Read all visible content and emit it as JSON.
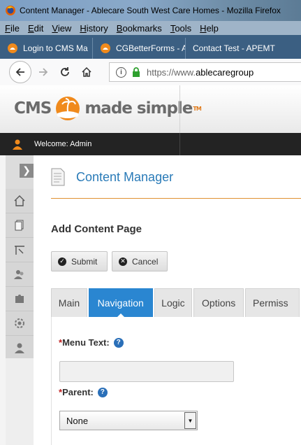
{
  "window": {
    "title": "Content Manager - Ablecare South West Care Homes - Mozilla Firefox"
  },
  "menubar": {
    "items": [
      {
        "mnemonic": "F",
        "rest": "ile"
      },
      {
        "mnemonic": "E",
        "rest": "dit"
      },
      {
        "mnemonic": "V",
        "rest": "iew"
      },
      {
        "mnemonic": "H",
        "rest": "istory"
      },
      {
        "mnemonic": "B",
        "rest": "ookmarks"
      },
      {
        "mnemonic": "T",
        "rest": "ools"
      },
      {
        "mnemonic": "H",
        "rest": "elp"
      }
    ]
  },
  "browser_tabs": [
    {
      "label": "Login to CMS Ma"
    },
    {
      "label": "CGBetterForms - A"
    },
    {
      "label": "Contact Test - APEMT"
    }
  ],
  "navbar": {
    "url_prefix": "https://www.",
    "url_domain": "ablecaregroup"
  },
  "cms": {
    "logo_left": "CMS",
    "logo_right": "made simple",
    "logo_tm": "TM",
    "welcome": "Welcome: Admin"
  },
  "page": {
    "title": "Content Manager",
    "subtitle": "Add Content Page",
    "submit_label": "Submit",
    "cancel_label": "Cancel"
  },
  "content_tabs": [
    {
      "label": "Main",
      "active": false
    },
    {
      "label": "Navigation",
      "active": true
    },
    {
      "label": "Logic",
      "active": false
    },
    {
      "label": "Options",
      "active": false
    },
    {
      "label": "Permiss",
      "active": false
    }
  ],
  "form": {
    "menu_text_label": "Menu Text:",
    "menu_text_value": "",
    "parent_label": "Parent:",
    "parent_value": "None",
    "required_mark": "*",
    "help_glyph": "?"
  },
  "colors": {
    "accent": "#2a86d1",
    "title_blue": "#2a7bb8",
    "orange": "#e09030",
    "dark_bar": "#232323"
  }
}
